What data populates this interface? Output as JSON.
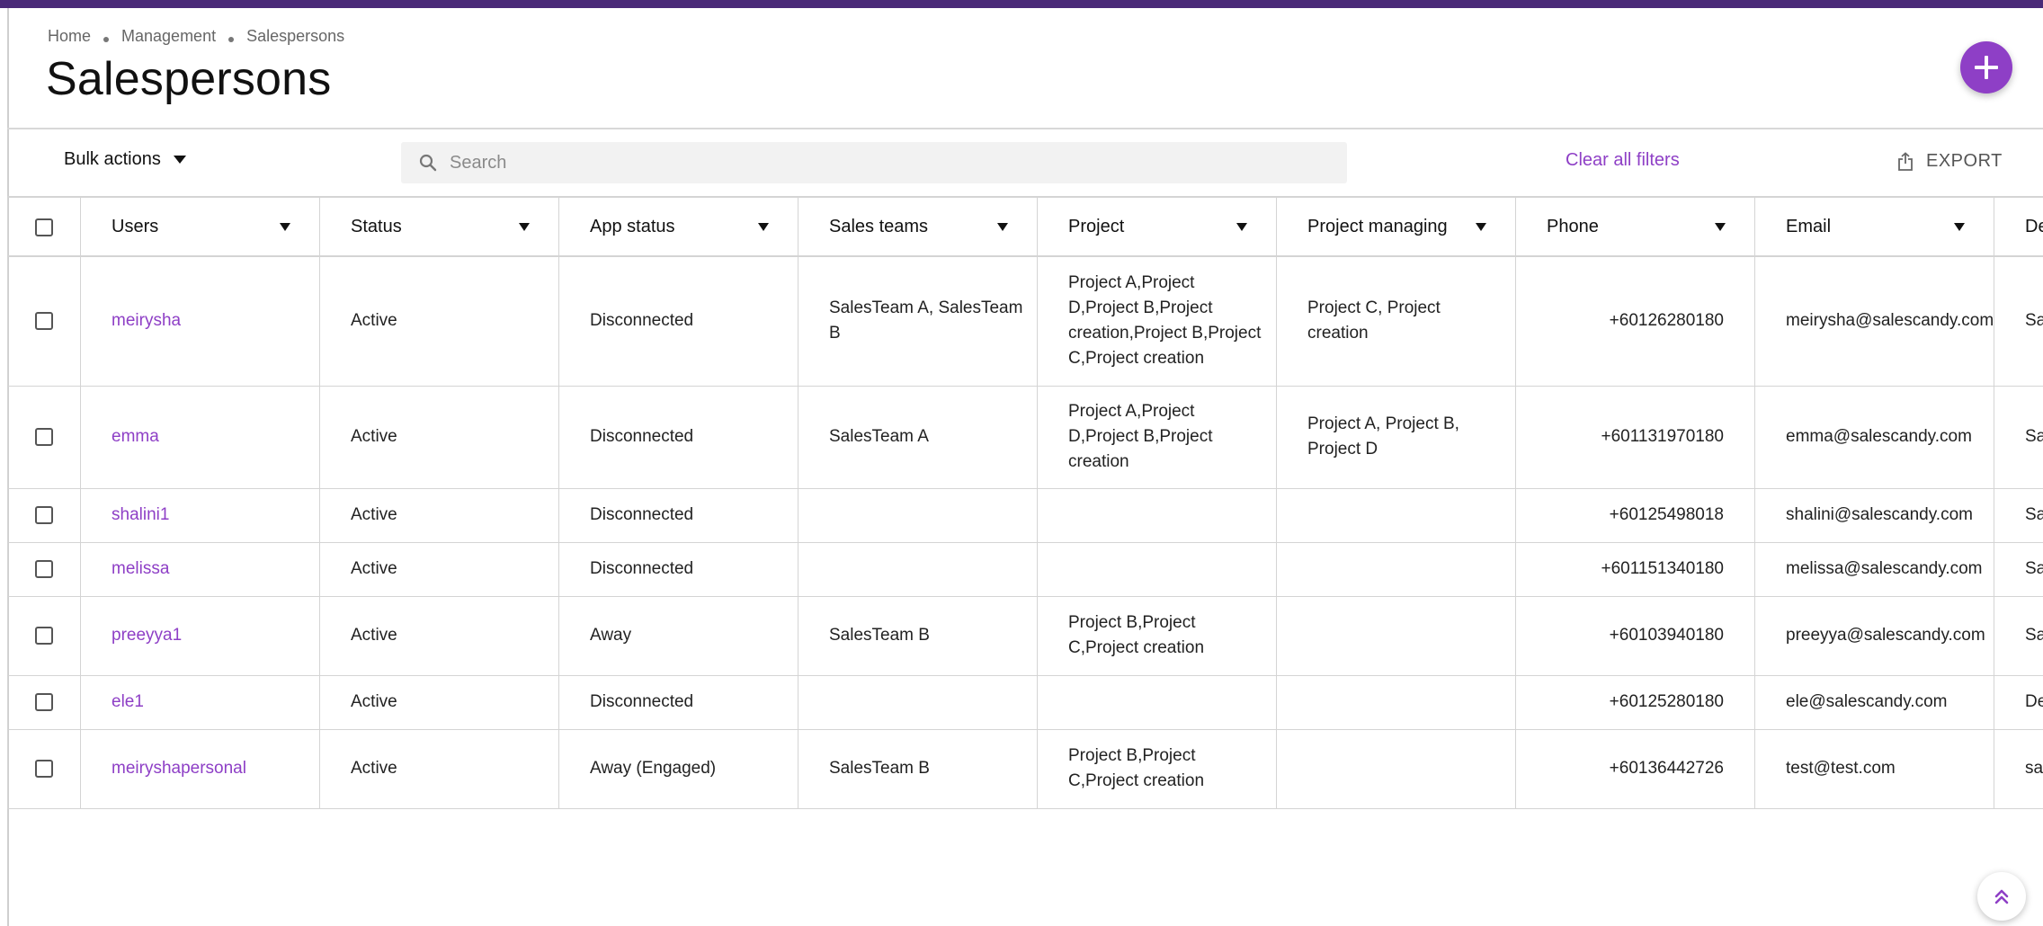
{
  "breadcrumb": [
    "Home",
    "Management",
    "Salespersons"
  ],
  "page_title": "Salespersons",
  "toolbar": {
    "bulk_actions_label": "Bulk actions",
    "search_placeholder": "Search",
    "search_value": "",
    "clear_filters_label": "Clear all filters",
    "export_label": "EXPORT"
  },
  "colors": {
    "accent": "#8e3fc6",
    "topbar": "#4a2a78"
  },
  "icons": {
    "add": "plus-icon",
    "search": "search-icon",
    "export": "export-icon",
    "scroll_top": "double-chevron-up-icon"
  },
  "table": {
    "columns": [
      "Users",
      "Status",
      "App status",
      "Sales teams",
      "Project",
      "Project managing",
      "Phone",
      "Email",
      "De"
    ],
    "rows": [
      {
        "user": "meirysha",
        "status": "Active",
        "app_status": "Disconnected",
        "sales_teams": "SalesTeam A, SalesTeam B",
        "project": "Project A,Project D,Project B,Project creation,Project B,Project C,Project creation",
        "project_managing": "Project C, Project creation",
        "phone": "+60126280180",
        "email": "meirysha@salescandy.com",
        "extra": "Sa"
      },
      {
        "user": "emma",
        "status": "Active",
        "app_status": "Disconnected",
        "sales_teams": "SalesTeam A",
        "project": "Project A,Project D,Project B,Project creation",
        "project_managing": "Project A, Project B, Project D",
        "phone": "+601131970180",
        "email": "emma@salescandy.com",
        "extra": "Sa"
      },
      {
        "user": "shalini1",
        "status": "Active",
        "app_status": "Disconnected",
        "sales_teams": "",
        "project": "",
        "project_managing": "",
        "phone": "+60125498018",
        "email": "shalini@salescandy.com",
        "extra": "Sa"
      },
      {
        "user": "melissa",
        "status": "Active",
        "app_status": "Disconnected",
        "sales_teams": "",
        "project": "",
        "project_managing": "",
        "phone": "+601151340180",
        "email": "melissa@salescandy.com",
        "extra": "Sa"
      },
      {
        "user": "preeyya1",
        "status": "Active",
        "app_status": "Away",
        "sales_teams": "SalesTeam B",
        "project": "Project B,Project C,Project creation",
        "project_managing": "",
        "phone": "+60103940180",
        "email": "preeyya@salescandy.com",
        "extra": "Sa"
      },
      {
        "user": "ele1",
        "status": "Active",
        "app_status": "Disconnected",
        "sales_teams": "",
        "project": "",
        "project_managing": "",
        "phone": "+60125280180",
        "email": "ele@salescandy.com",
        "extra": "De"
      },
      {
        "user": "meiryshapersonal",
        "status": "Active",
        "app_status": "Away (Engaged)",
        "sales_teams": "SalesTeam B",
        "project": "Project B,Project C,Project creation",
        "project_managing": "",
        "phone": "+60136442726",
        "email": "test@test.com",
        "extra": "sa"
      }
    ]
  }
}
